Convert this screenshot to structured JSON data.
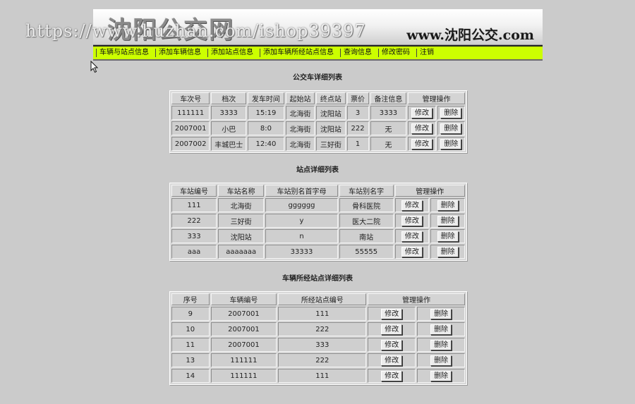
{
  "header": {
    "logo_text": "沈阳公交网",
    "site_url": "www.沈阳公交.com",
    "watermark": "https://www.huzhan.com/ishop39397"
  },
  "menu": [
    "车辆与站点信息",
    "添加车辆信息",
    "添加站点信息",
    "添加车辆所经站点信息",
    "查询信息",
    "修改密码",
    "注销"
  ],
  "buttons": {
    "edit": "修改",
    "delete": "删除"
  },
  "bus_table": {
    "title": "公交车详细列表",
    "headers": [
      "车次号",
      "档次",
      "发车时间",
      "起始站",
      "终点站",
      "票价",
      "备注信息",
      "管理操作"
    ],
    "rows": [
      [
        "111111",
        "3333",
        "15:19",
        "北海街",
        "沈阳站",
        "3",
        "3333"
      ],
      [
        "2007001",
        "小巴",
        "8:0",
        "北海街",
        "沈阳站",
        "222",
        "无"
      ],
      [
        "2007002",
        "丰城巴士",
        "12:40",
        "北海街",
        "三好街",
        "1",
        "无"
      ]
    ]
  },
  "station_table": {
    "title": "站点详细列表",
    "headers": [
      "车站编号",
      "车站名称",
      "车站别名首字母",
      "车站别名字",
      "管理操作"
    ],
    "rows": [
      [
        "111",
        "北海街",
        "gggggg",
        "骨科医院"
      ],
      [
        "222",
        "三好街",
        "y",
        "医大二院"
      ],
      [
        "333",
        "沈阳站",
        "n",
        "南站"
      ],
      [
        "aaa",
        "aaaaaaa",
        "33333",
        "55555"
      ]
    ]
  },
  "route_table": {
    "title": "车辆所经站点详细列表",
    "headers": [
      "序号",
      "车辆编号",
      "所经站点编号",
      "管理操作"
    ],
    "rows": [
      [
        "9",
        "2007001",
        "111"
      ],
      [
        "10",
        "2007001",
        "222"
      ],
      [
        "11",
        "2007001",
        "333"
      ],
      [
        "13",
        "111111",
        "222"
      ],
      [
        "14",
        "111111",
        "111"
      ]
    ]
  }
}
